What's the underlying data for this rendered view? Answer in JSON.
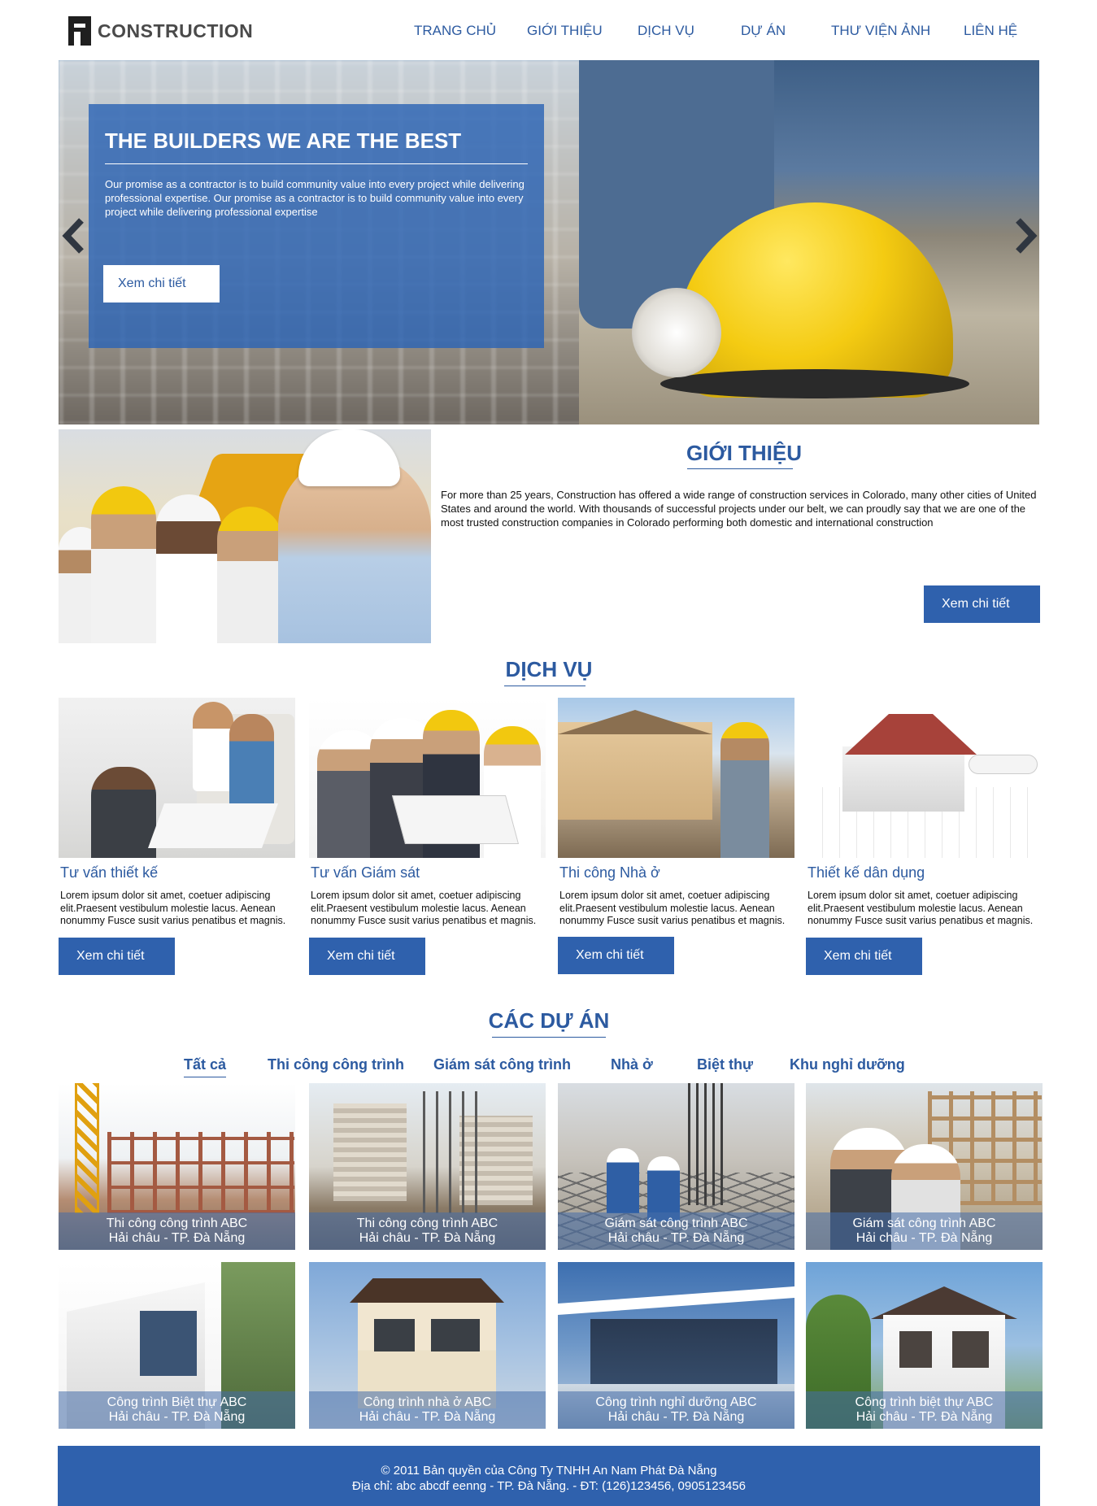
{
  "header": {
    "logo_text": "CONSTRUCTION",
    "nav": [
      "TRANG CHỦ",
      "GIỚI THIỆU",
      "DỊCH VỤ",
      "DỰ ÁN",
      "THƯ VIỆN ẢNH",
      "LIÊN HỆ"
    ]
  },
  "hero": {
    "title": "THE BUILDERS WE ARE THE BEST",
    "text": "Our promise as a contractor is to build community value into every project while delivering professional expertise. Our promise as a contractor is to build community value into every project while delivering professional expertise",
    "button": "Xem chi tiết"
  },
  "about": {
    "title": "GIỚI THIỆU",
    "text": "For more than 25 years, Construction has offered a wide range of construction services in Colorado, many other cities of United States and around the world. With thousands of successful projects under our belt, we can proudly say that we are one of the most trusted construction companies in Colorado performing both domestic and international construction",
    "button": "Xem chi tiết"
  },
  "services": {
    "title": "DỊCH VỤ",
    "items": [
      {
        "title": "Tư vấn thiết kế",
        "text": "Lorem ipsum dolor sit amet, coetuer adipiscing elit.Praesent vestibulum molestie lacus. Aenean nonummy Fusce susit varius penatibus et magnis.",
        "button": "Xem chi tiết"
      },
      {
        "title": "Tư vấn Giám sát",
        "text": "Lorem ipsum dolor sit amet, coetuer adipiscing elit.Praesent vestibulum molestie lacus. Aenean nonummy Fusce susit varius penatibus et magnis.",
        "button": "Xem chi tiết"
      },
      {
        "title": "Thi công Nhà ở",
        "text": "Lorem ipsum dolor sit amet, coetuer adipiscing elit.Praesent vestibulum molestie lacus. Aenean nonummy Fusce susit varius penatibus et magnis.",
        "button": "Xem chi tiết"
      },
      {
        "title": "Thiết kế dân dụng",
        "text": "Lorem ipsum dolor sit amet, coetuer adipiscing elit.Praesent vestibulum molestie lacus. Aenean nonummy Fusce susit varius penatibus et magnis.",
        "button": "Xem chi tiết"
      }
    ]
  },
  "projects": {
    "title": "CÁC DỰ ÁN",
    "filters": [
      "Tất cả",
      "Thi công công trình",
      "Giám sát công trình",
      "Nhà ở",
      "Biệt thự",
      "Khu nghỉ dưỡng"
    ],
    "active_filter": "Tất cả",
    "items": [
      {
        "line1": "Thi công công trình ABC",
        "line2": "Hải châu - TP. Đà Nẵng"
      },
      {
        "line1": "Thi công công trình  ABC",
        "line2": "Hải châu - TP. Đà Nẵng"
      },
      {
        "line1": "Giám sát công trình ABC",
        "line2": "Hải châu - TP. Đà Nẵng"
      },
      {
        "line1": "Giám sát công trình ABC",
        "line2": "Hải châu - TP. Đà Nẵng"
      },
      {
        "line1": "Công trình Biệt thự ABC",
        "line2": "Hải châu - TP. Đà Nẵng"
      },
      {
        "line1": "Công trình nhà ở ABC",
        "line2": "Hải châu - TP. Đà Nẵng"
      },
      {
        "line1": "Công trình nghỉ dưỡng ABC",
        "line2": "Hải châu - TP. Đà Nẵng"
      },
      {
        "line1": "Công trình biệt thự ABC",
        "line2": "Hải châu - TP. Đà Nẵng"
      }
    ]
  },
  "footer": {
    "line1": "© 2011 Bản quyền của Công Ty  TNHH An Nam Phát Đà Nẵng",
    "line2": "Địa chỉ: abc abcdf eenng - TP. Đà Nẵng. - ĐT: (126)123456, 0905123456"
  },
  "colors": {
    "brand_blue": "#2c5aa0",
    "button_blue": "#2f61ad",
    "hero_overlay": "#2c64b4"
  },
  "icons": [
    "logo-mark-icon",
    "chevron-left-icon",
    "chevron-right-icon"
  ]
}
